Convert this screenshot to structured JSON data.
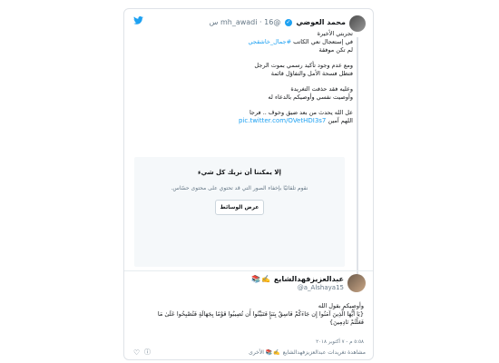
{
  "tweet": {
    "author_name": "محمد العوضي",
    "handle": "@mh_awadi",
    "time": "16 س",
    "lines": [
      "تجربتي الأخيرة",
      "في إستعجال نعي الكاتب",
      "لم تكن موفقة"
    ],
    "hashtag": "#جمال_خاشقجي",
    "para2": [
      "ومع عدم وجود تأكيد رسمي بموت الرجل",
      "فتظل فسحة  الأمل والتفاؤل قائمة"
    ],
    "para3": [
      "وعليه فقد حذفت التغريدة",
      "وأوصيت نفسي وأوصيكم بالدعاء له"
    ],
    "para4": [
      "عل الله يحدث من بعد ضيق وخوف .. فرجا",
      "اللهم آمين"
    ],
    "link": "pic.twitter.com/OVetHDI3s7"
  },
  "media_notice": {
    "title": "إلا يمكننا أن نريك كل شيء",
    "subtitle": "نقوم تلقائيًا بإخفاء الصور التي قد تحتوي على محتوى حسّاس.",
    "button": "عرض الوسائط"
  },
  "reply": {
    "author_name": "عبدالعزيزفهدالشايع",
    "emojis": "✍️📚",
    "handle": "@a_Alshaya15",
    "line1": "وأوصيكم بقول الله",
    "line2": "{يَا أَيُّهَا الَّذِينَ آمَنُوا إِن جَاءَكُمْ فَاسِقٌ بِنَبَإٍ فَتَبَيَّنُوا أَن تُصِيبُوا قَوْمًا بِجَهَالَةٍ فَتُصْبِحُوا عَلَىٰ مَا",
    "line3": "فَعَلْتُمْ نَادِمِينَ}",
    "meta": "٥:٥٨ م - ٧ أكتوبر ٢٠١٨",
    "actions_text": "مشاهدة تغريدات عبدالعزيزفهدالشايع",
    "actions_suffix": "الأخرى"
  }
}
